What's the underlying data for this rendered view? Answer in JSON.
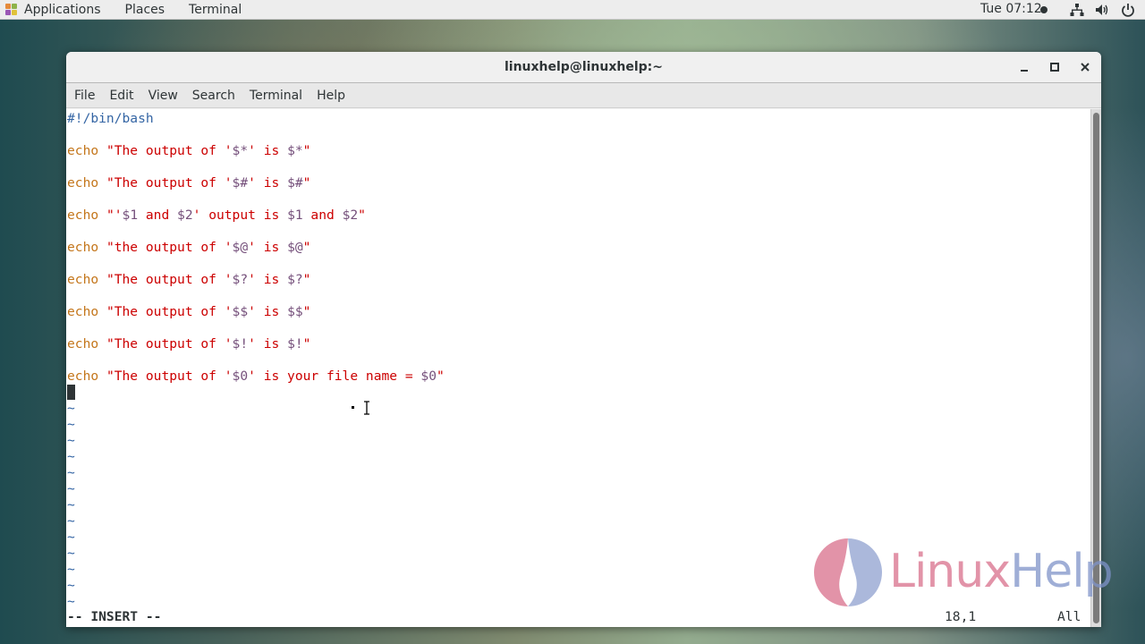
{
  "topbar": {
    "applications_label": "Applications",
    "places_label": "Places",
    "terminal_label": "Terminal",
    "clock": "Tue 07:12",
    "tray_icons": [
      "network-icon",
      "volume-icon",
      "power-icon"
    ]
  },
  "window": {
    "title": "linuxhelp@linuxhelp:~",
    "controls": [
      "minimize",
      "maximize",
      "close"
    ],
    "menu": [
      "File",
      "Edit",
      "View",
      "Search",
      "Terminal",
      "Help"
    ]
  },
  "editor": {
    "lines": [
      {
        "tokens": [
          {
            "t": "#!/bin/bash",
            "c": "cmt"
          }
        ]
      },
      {
        "tokens": []
      },
      {
        "tokens": [
          {
            "t": "echo",
            "c": "kw"
          },
          {
            "t": " ",
            "c": ""
          },
          {
            "t": "\"The output of '",
            "c": "str"
          },
          {
            "t": "$*",
            "c": "var"
          },
          {
            "t": "' is ",
            "c": "str"
          },
          {
            "t": "$*",
            "c": "var"
          },
          {
            "t": "\"",
            "c": "str"
          }
        ]
      },
      {
        "tokens": []
      },
      {
        "tokens": [
          {
            "t": "echo",
            "c": "kw"
          },
          {
            "t": " ",
            "c": ""
          },
          {
            "t": "\"The output of '",
            "c": "str"
          },
          {
            "t": "$#",
            "c": "var"
          },
          {
            "t": "' is ",
            "c": "str"
          },
          {
            "t": "$#",
            "c": "var"
          },
          {
            "t": "\"",
            "c": "str"
          }
        ]
      },
      {
        "tokens": []
      },
      {
        "tokens": [
          {
            "t": "echo",
            "c": "kw"
          },
          {
            "t": " ",
            "c": ""
          },
          {
            "t": "\"'",
            "c": "str"
          },
          {
            "t": "$1",
            "c": "var"
          },
          {
            "t": " and ",
            "c": "str"
          },
          {
            "t": "$2",
            "c": "var"
          },
          {
            "t": "' output is ",
            "c": "str"
          },
          {
            "t": "$1",
            "c": "var"
          },
          {
            "t": " and ",
            "c": "str"
          },
          {
            "t": "$2",
            "c": "var"
          },
          {
            "t": "\"",
            "c": "str"
          }
        ]
      },
      {
        "tokens": []
      },
      {
        "tokens": [
          {
            "t": "echo",
            "c": "kw"
          },
          {
            "t": " ",
            "c": ""
          },
          {
            "t": "\"the output of '",
            "c": "str"
          },
          {
            "t": "$@",
            "c": "var"
          },
          {
            "t": "' is ",
            "c": "str"
          },
          {
            "t": "$@",
            "c": "var"
          },
          {
            "t": "\"",
            "c": "str"
          }
        ]
      },
      {
        "tokens": []
      },
      {
        "tokens": [
          {
            "t": "echo",
            "c": "kw"
          },
          {
            "t": " ",
            "c": ""
          },
          {
            "t": "\"The output of '",
            "c": "str"
          },
          {
            "t": "$?",
            "c": "var"
          },
          {
            "t": "' is ",
            "c": "str"
          },
          {
            "t": "$?",
            "c": "var"
          },
          {
            "t": "\"",
            "c": "str"
          }
        ]
      },
      {
        "tokens": []
      },
      {
        "tokens": [
          {
            "t": "echo",
            "c": "kw"
          },
          {
            "t": " ",
            "c": ""
          },
          {
            "t": "\"The output of '",
            "c": "str"
          },
          {
            "t": "$$",
            "c": "var"
          },
          {
            "t": "' is ",
            "c": "str"
          },
          {
            "t": "$$",
            "c": "var"
          },
          {
            "t": "\"",
            "c": "str"
          }
        ]
      },
      {
        "tokens": []
      },
      {
        "tokens": [
          {
            "t": "echo",
            "c": "kw"
          },
          {
            "t": " ",
            "c": ""
          },
          {
            "t": "\"The output of '",
            "c": "str"
          },
          {
            "t": "$!",
            "c": "var"
          },
          {
            "t": "' is ",
            "c": "str"
          },
          {
            "t": "$!",
            "c": "var"
          },
          {
            "t": "\"",
            "c": "str"
          }
        ]
      },
      {
        "tokens": []
      },
      {
        "tokens": [
          {
            "t": "echo",
            "c": "kw"
          },
          {
            "t": " ",
            "c": ""
          },
          {
            "t": "\"The output of '",
            "c": "str"
          },
          {
            "t": "$0",
            "c": "var"
          },
          {
            "t": "' is your file name = ",
            "c": "str"
          },
          {
            "t": "$0",
            "c": "var"
          },
          {
            "t": "\"",
            "c": "str"
          }
        ]
      }
    ],
    "tilde_count": 13,
    "tilde_char": "~",
    "status": {
      "mode": "-- INSERT --",
      "position": "18,1",
      "scroll": "All"
    }
  },
  "watermark": {
    "text_part1": "Linux",
    "text_part2": "Help",
    "color1": "#d9708c",
    "color2": "#7f93c9"
  },
  "colors": {
    "keyword": "#c4761b",
    "string": "#cc0000",
    "variable": "#75507b",
    "comment": "#3465a4"
  }
}
